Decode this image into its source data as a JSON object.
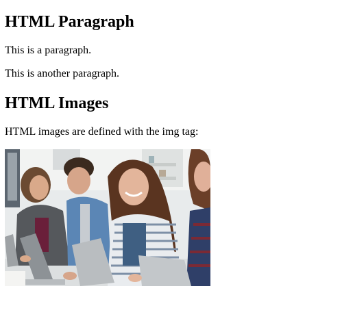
{
  "sections": [
    {
      "heading": "HTML Paragraph",
      "paragraphs": [
        "This is a paragraph.",
        "This is another paragraph."
      ]
    },
    {
      "heading": "HTML Images",
      "paragraphs": [
        "HTML images are defined with the img tag:"
      ]
    }
  ]
}
